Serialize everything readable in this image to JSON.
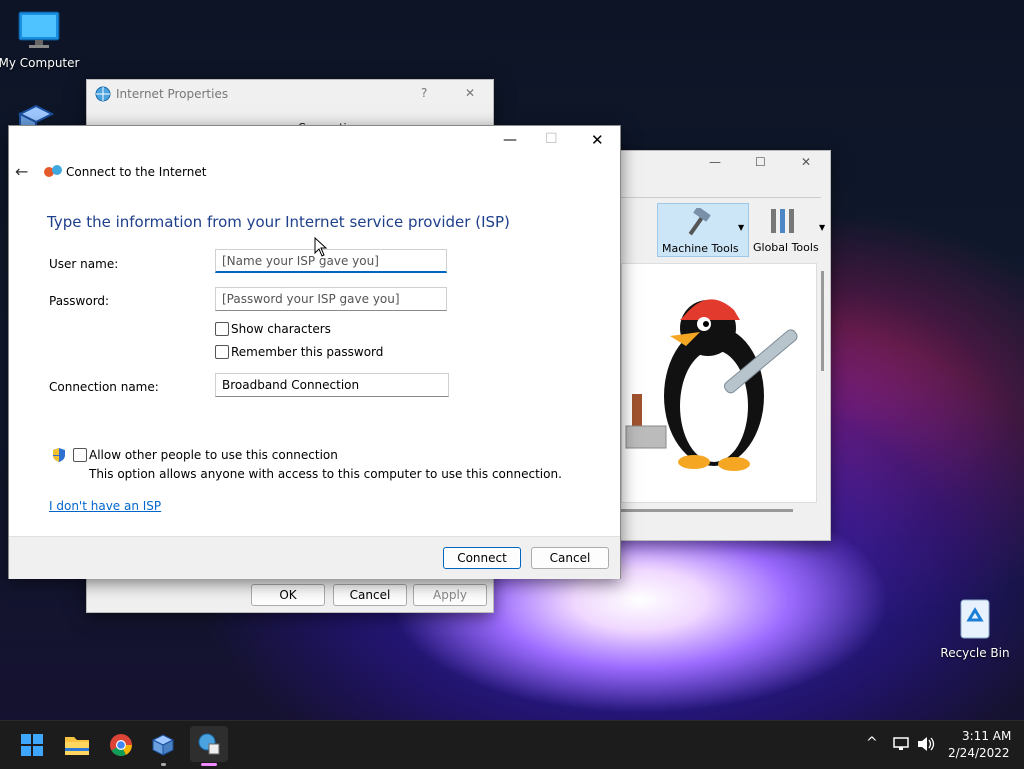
{
  "desktop": {
    "my_computer_label": "My Computer",
    "recycle_bin_label": "Recycle Bin"
  },
  "internet_properties": {
    "title": "Internet Properties",
    "help_glyph": "?",
    "close_glyph": "✕",
    "active_tab": "Connections",
    "ok_label": "OK",
    "cancel_label": "Cancel",
    "apply_label": "Apply"
  },
  "virtualbox_window": {
    "machine_tools_label": "Machine Tools",
    "global_tools_label": "Global Tools"
  },
  "dialog": {
    "title": "Connect to the Internet",
    "heading": "Type the information from your Internet service provider (ISP)",
    "user_name_label": "User name:",
    "user_name_placeholder": "[Name your ISP gave you]",
    "password_label": "Password:",
    "password_placeholder": "[Password your ISP gave you]",
    "show_characters_label": "Show characters",
    "remember_password_label": "Remember this password",
    "connection_name_label": "Connection name:",
    "connection_name_value": "Broadband Connection",
    "allow_others_label": "Allow other people to use this connection",
    "allow_others_desc": "This option allows anyone with access to this computer to use this connection.",
    "no_isp_link": "I don't have an ISP",
    "connect_label": "Connect",
    "cancel_label": "Cancel"
  },
  "taskbar": {
    "time": "3:11 AM",
    "date": "2/24/2022"
  },
  "colors": {
    "accent": "#0067c0",
    "heading": "#1e3f8a",
    "link": "#0066cc",
    "taskbar": "#1c1c1c"
  }
}
